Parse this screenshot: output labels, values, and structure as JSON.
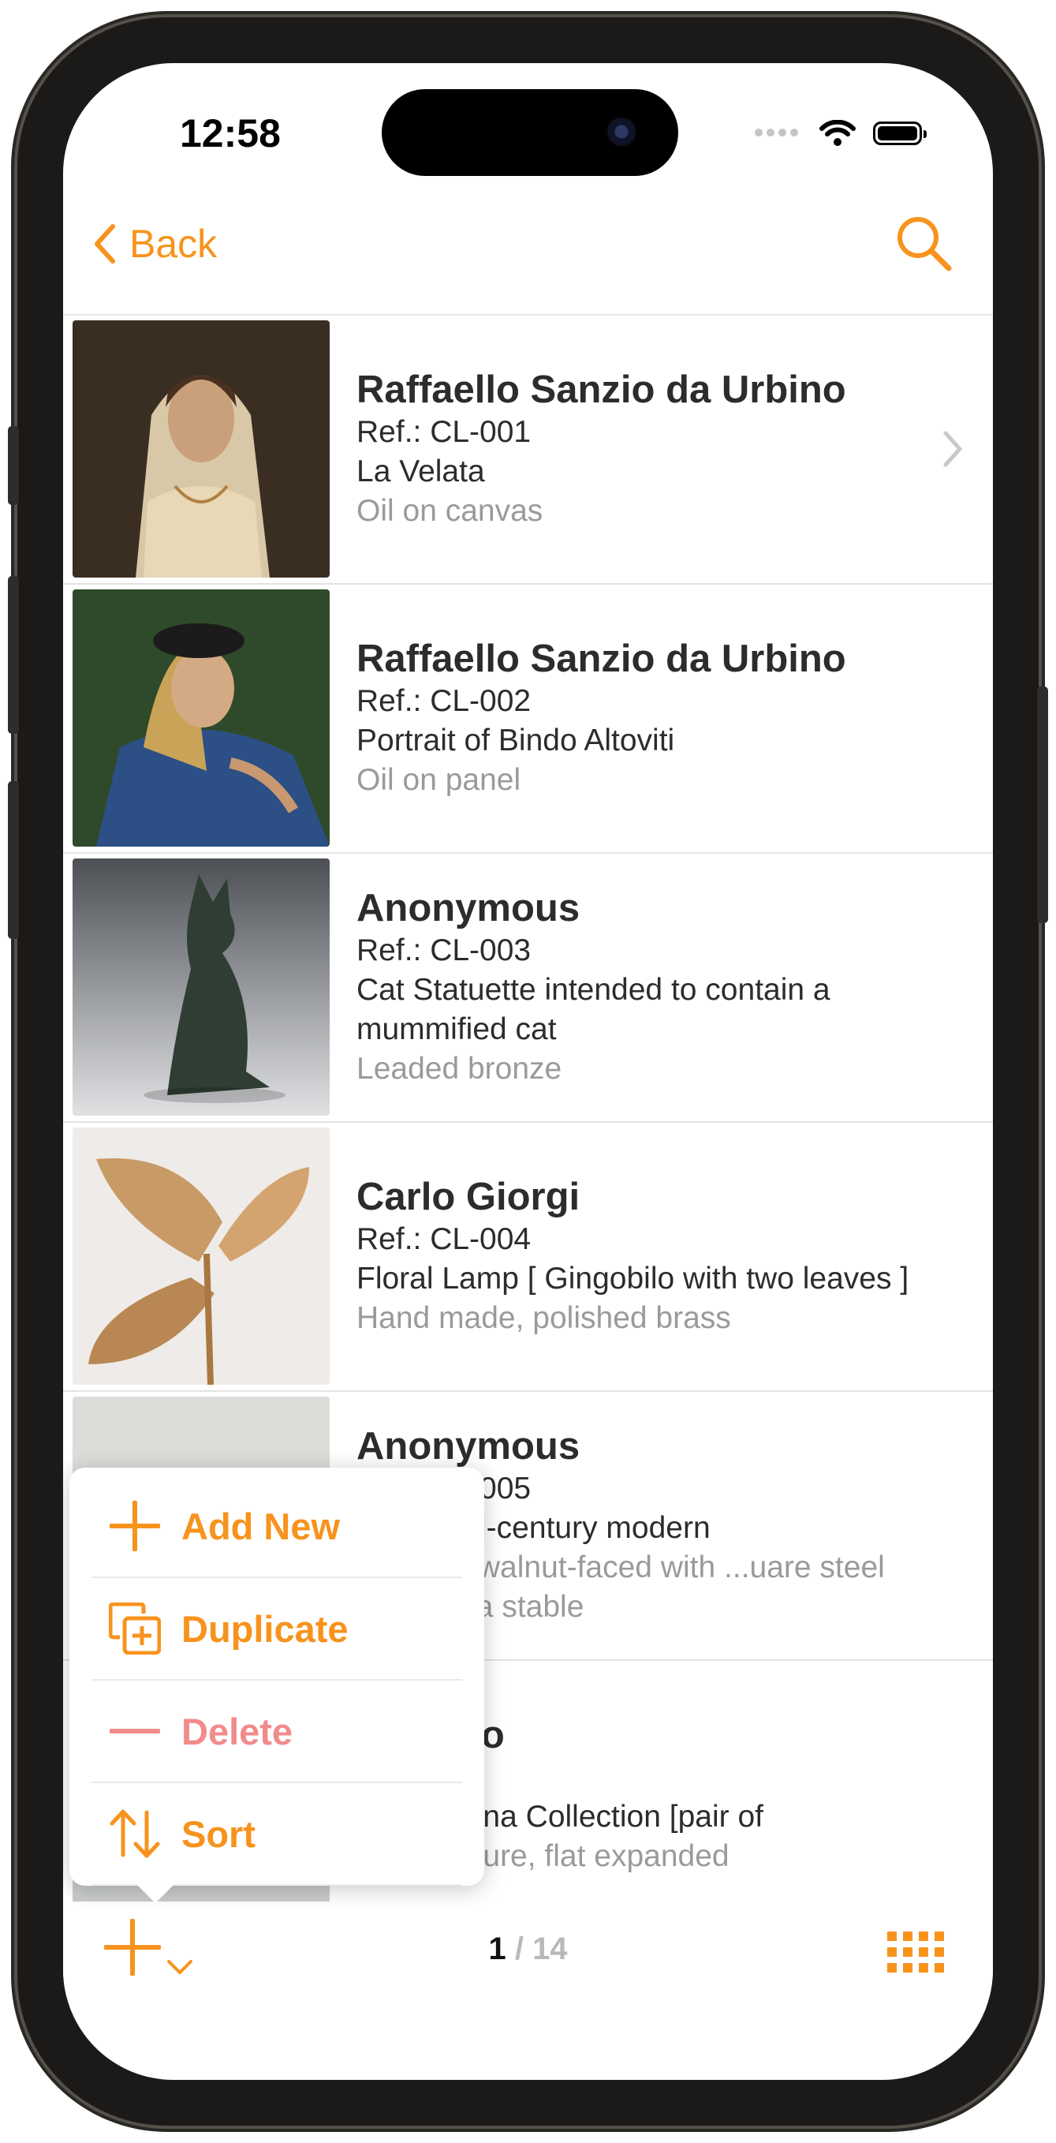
{
  "status_bar": {
    "time": "12:58"
  },
  "nav": {
    "back_label": "Back"
  },
  "colors": {
    "accent": "#f7931d",
    "delete": "#f28b8b",
    "secondary_text": "#9a9a9a"
  },
  "items": [
    {
      "artist": "Raffaello Sanzio da Urbino",
      "ref": "Ref.: CL-001",
      "title": "La Velata",
      "medium": "Oil on canvas"
    },
    {
      "artist": "Raffaello Sanzio da Urbino",
      "ref": "Ref.: CL-002",
      "title": "Portrait of Bindo Altoviti",
      "medium": "Oil on panel"
    },
    {
      "artist": "Anonymous",
      "ref": "Ref.: CL-003",
      "title": "Cat Statuette intended to contain a mummified cat",
      "medium": "Leaded bronze"
    },
    {
      "artist": "Carlo Giorgi",
      "ref": "Ref.: CL-004",
      "title": "Floral Lamp [ Gingobilo with two leaves ]",
      "medium": "Hand made, polished brass"
    },
    {
      "artist": "Anonymous",
      "ref": "Ref.: CL-005",
      "title": "...stic mid-century modern",
      "medium": "...frame, walnut-faced with ...uare steel feet and a stable"
    },
    {
      "artist": "...studio",
      "ref": "...006",
      "title": "...01, Alpina Collection [pair of",
      "medium": "...n structure, flat expanded"
    }
  ],
  "menu": {
    "items": [
      {
        "label": "Add New",
        "icon": "plus-icon"
      },
      {
        "label": "Duplicate",
        "icon": "duplicate-icon"
      },
      {
        "label": "Delete",
        "icon": "minus-icon"
      },
      {
        "label": "Sort",
        "icon": "sort-icon"
      }
    ]
  },
  "toolbar": {
    "page_current": "1",
    "page_separator": "/",
    "page_total": "14"
  }
}
